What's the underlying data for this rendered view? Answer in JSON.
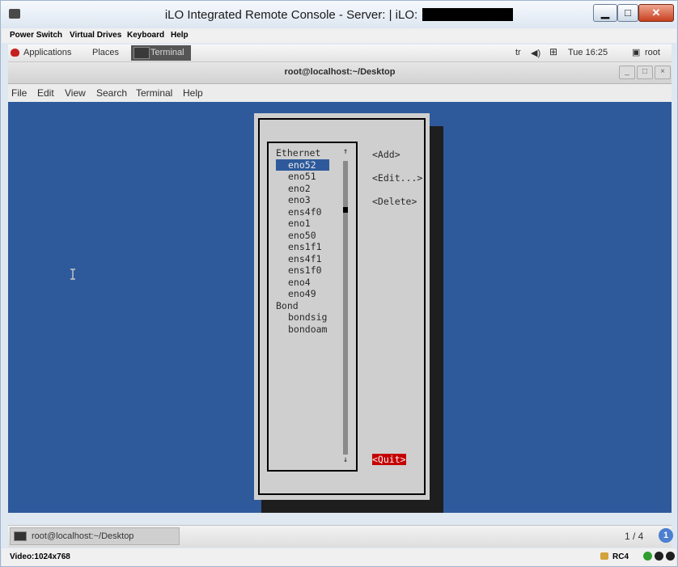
{
  "ilo": {
    "title": "iLO Integrated Remote Console - Server:  | iLO:",
    "menu": [
      "Power Switch",
      "Virtual Drives",
      "Keyboard",
      "Help"
    ],
    "status_video": "Video:1024x768",
    "status_cipher": "RC4",
    "colors": {
      "led1": "#2f9e2f",
      "led2": "#1f1f1f",
      "led3": "#1f1f1f"
    }
  },
  "panel": {
    "applications": "Applications",
    "places": "Places",
    "terminal_launcher": "Terminal",
    "keyboard_layout": "tr",
    "clock": "Tue 16:25",
    "user": "root"
  },
  "terminal": {
    "title": "root@localhost:~/Desktop",
    "menu": [
      "File",
      "Edit",
      "View",
      "Search",
      "Terminal",
      "Help"
    ]
  },
  "nmtui": {
    "list": [
      {
        "text": "Ethernet",
        "indent": false,
        "selected": false
      },
      {
        "text": "eno52",
        "indent": true,
        "selected": true
      },
      {
        "text": "eno51",
        "indent": true,
        "selected": false
      },
      {
        "text": "eno2",
        "indent": true,
        "selected": false
      },
      {
        "text": "eno3",
        "indent": true,
        "selected": false
      },
      {
        "text": "ens4f0",
        "indent": true,
        "selected": false
      },
      {
        "text": "eno1",
        "indent": true,
        "selected": false
      },
      {
        "text": "eno50",
        "indent": true,
        "selected": false
      },
      {
        "text": "ens1f1",
        "indent": true,
        "selected": false
      },
      {
        "text": "ens4f1",
        "indent": true,
        "selected": false
      },
      {
        "text": "ens1f0",
        "indent": true,
        "selected": false
      },
      {
        "text": "eno4",
        "indent": true,
        "selected": false
      },
      {
        "text": "eno49",
        "indent": true,
        "selected": false
      },
      {
        "text": "Bond",
        "indent": false,
        "selected": false
      },
      {
        "text": "bondsig",
        "indent": true,
        "selected": false
      },
      {
        "text": "bondoam",
        "indent": true,
        "selected": false
      }
    ],
    "actions": {
      "add": "<Add>",
      "edit": "<Edit...>",
      "delete": "<Delete>",
      "quit": "<Quit>"
    },
    "scroll_up": "↑",
    "scroll_down": "↓"
  },
  "taskbar": {
    "task": "root@localhost:~/Desktop",
    "workspace": "1 / 4",
    "notifications": "1"
  }
}
